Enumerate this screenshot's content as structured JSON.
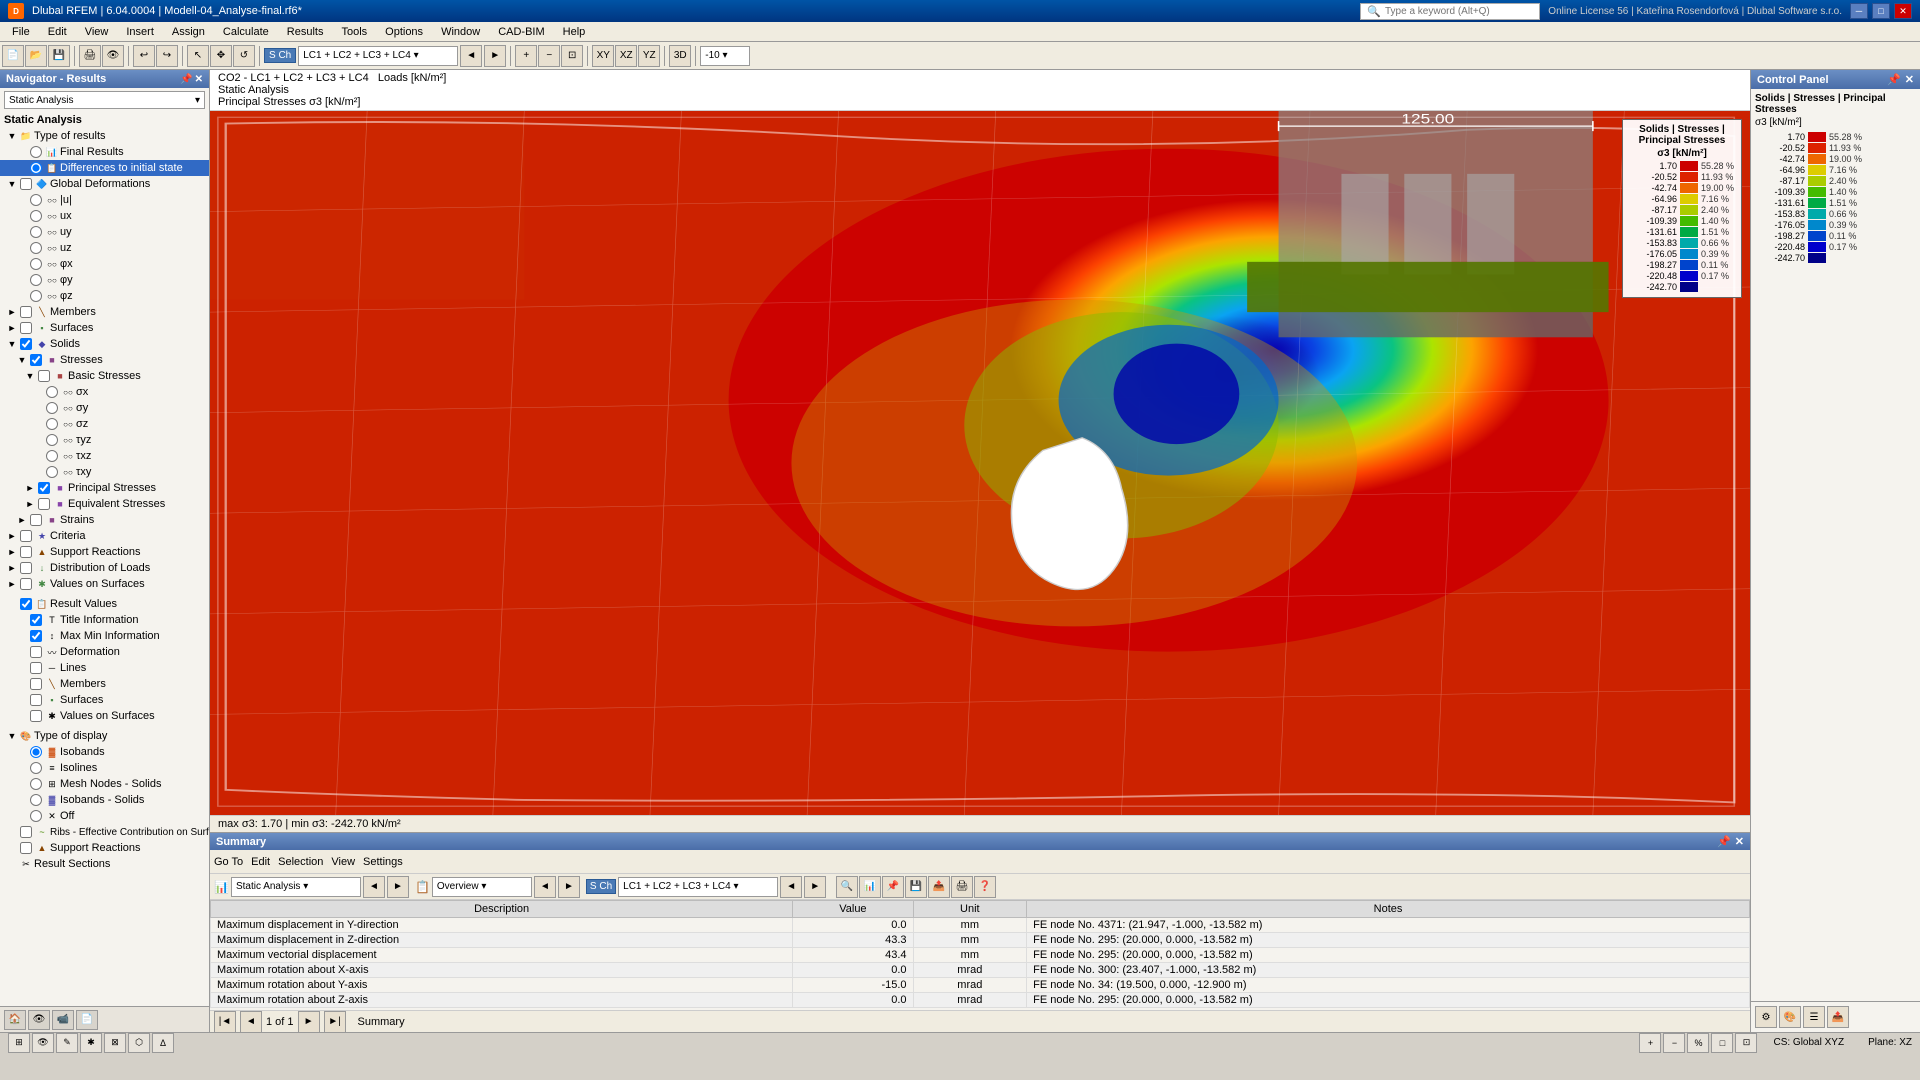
{
  "titlebar": {
    "title": "Dlubal RFEM | 6.04.0004 | Modell-04_Analyse-final.rf6*",
    "license": "Online License 56 | Kateřina Rosendorfová | Dlubal Software s.r.o.",
    "search_placeholder": "Type a keyword (Alt+Q)"
  },
  "menubar": {
    "items": [
      "File",
      "Edit",
      "View",
      "Insert",
      "Assign",
      "Calculate",
      "Results",
      "Tools",
      "Options",
      "Window",
      "CAD-BIM",
      "Help"
    ]
  },
  "navigator": {
    "title": "Navigator - Results",
    "dropdown": "Static Analysis",
    "tree": {
      "type_of_results": "Type of results",
      "final_results": "Final Results",
      "differences": "Differences to initial state",
      "global_deformations": "Global Deformations",
      "u": "|u|",
      "ux": "ux",
      "uy": "uy",
      "uz": "uz",
      "phi_x": "φx",
      "phi_y": "φy",
      "phi_z": "φz",
      "members": "Members",
      "surfaces": "Surfaces",
      "solids": "Solids",
      "stresses": "Stresses",
      "basic_stresses": "Basic Stresses",
      "sigma_x": "σx",
      "sigma_y": "σy",
      "sigma_z": "σz",
      "tau_yz": "τyz",
      "tau_xz": "τxz",
      "tau_xy": "τxy",
      "principal_stresses": "Principal Stresses",
      "equivalent_stresses": "Equivalent Stresses",
      "strains": "Strains",
      "criteria": "Criteria",
      "support_reactions": "Support Reactions",
      "distribution_of_loads": "Distribution of Loads",
      "values_on_surfaces": "Values on Surfaces",
      "result_values": "Result Values",
      "title_information": "Title Information",
      "max_min_information": "Max Min Information",
      "deformation": "Deformation",
      "lines": "Lines",
      "members_nav": "Members",
      "surfaces_nav": "Surfaces",
      "values_on_surfaces_nav": "Values on Surfaces",
      "type_of_display": "Type of display",
      "isobands": "Isobands",
      "isolines": "Isolines",
      "mesh_nodes_solids": "Mesh Nodes - Solids",
      "isobands_solids": "Isobands - Solids",
      "off": "Off",
      "ribs": "Ribs - Effective Contribution on Surfa...",
      "support_reactions_nav": "Support Reactions",
      "result_sections": "Result Sections"
    }
  },
  "info_bar": {
    "line1": "CO2 - LC1 + LC2 + LC3 + LC4",
    "line2": "Loads [kN/m²]",
    "line3": "Static Analysis",
    "line4": "Principal Stresses σ3 [kN/m²]"
  },
  "viewport": {
    "status": "max σ3: 1.70 | min σ3: -242.70 kN/m²"
  },
  "color_scale": {
    "title": "Solids | Principal Stresses σ3 [kN/m²]",
    "values": [
      {
        "val": "1.70",
        "pct": "55.28 %",
        "color": "#cc0000"
      },
      {
        "val": "-20.52",
        "pct": "11.93 %",
        "color": "#dd2200"
      },
      {
        "val": "-42.74",
        "pct": "19.00 %",
        "color": "#ee6600"
      },
      {
        "val": "-64.96",
        "pct": "7.16 %",
        "color": "#ddcc00"
      },
      {
        "val": "-87.17",
        "pct": "2.40 %",
        "color": "#aacc00"
      },
      {
        "val": "-109.39",
        "pct": "1.40 %",
        "color": "#44bb00"
      },
      {
        "val": "-131.61",
        "pct": "1.51 %",
        "color": "#00aa44"
      },
      {
        "val": "-153.83",
        "pct": "0.66 %",
        "color": "#00aaaa"
      },
      {
        "val": "-176.05",
        "pct": "0.39 %",
        "color": "#0088cc"
      },
      {
        "val": "-198.27",
        "pct": "0.11 %",
        "color": "#0044cc"
      },
      {
        "val": "-220.48",
        "pct": "0.17 %",
        "color": "#0000cc"
      },
      {
        "val": "-242.70",
        "pct": "",
        "color": "#000088"
      }
    ]
  },
  "summary": {
    "title": "Summary",
    "menu_items": [
      "Go To",
      "Edit",
      "Selection",
      "View",
      "Settings"
    ],
    "analysis_type": "Static Analysis",
    "view_type": "Overview",
    "combination": "LC1 + LC2 + LC3 + LC4",
    "combination_code": "S Ch  CO2",
    "table_headers": [
      "Description",
      "Value",
      "Unit",
      "Notes"
    ],
    "table_rows": [
      {
        "desc": "Maximum displacement in Y-direction",
        "val": "0.0",
        "unit": "mm",
        "note": "FE node No. 4371: (21.947, -1.000, -13.582 m)"
      },
      {
        "desc": "Maximum displacement in Z-direction",
        "val": "43.3",
        "unit": "mm",
        "note": "FE node No. 295: (20.000, 0.000, -13.582 m)"
      },
      {
        "desc": "Maximum vectorial displacement",
        "val": "43.4",
        "unit": "mm",
        "note": "FE node No. 295: (20.000, 0.000, -13.582 m)"
      },
      {
        "desc": "Maximum rotation about X-axis",
        "val": "0.0",
        "unit": "mrad",
        "note": "FE node No. 300: (23.407, -1.000, -13.582 m)"
      },
      {
        "desc": "Maximum rotation about Y-axis",
        "val": "-15.0",
        "unit": "mrad",
        "note": "FE node No. 34: (19.500, 0.000, -12.900 m)"
      },
      {
        "desc": "Maximum rotation about Z-axis",
        "val": "0.0",
        "unit": "mrad",
        "note": "FE node No. 295: (20.000, 0.000, -13.582 m)"
      }
    ],
    "pagination": "1 of 1",
    "tab": "Summary"
  },
  "statusbar": {
    "cs": "CS: Global XYZ",
    "plane": "Plane: XZ"
  },
  "control_panel": {
    "title": "Control Panel",
    "subtitle1": "Solids | Stresses | Principal Stresses",
    "subtitle2": "σ3 [kN/m²]"
  }
}
